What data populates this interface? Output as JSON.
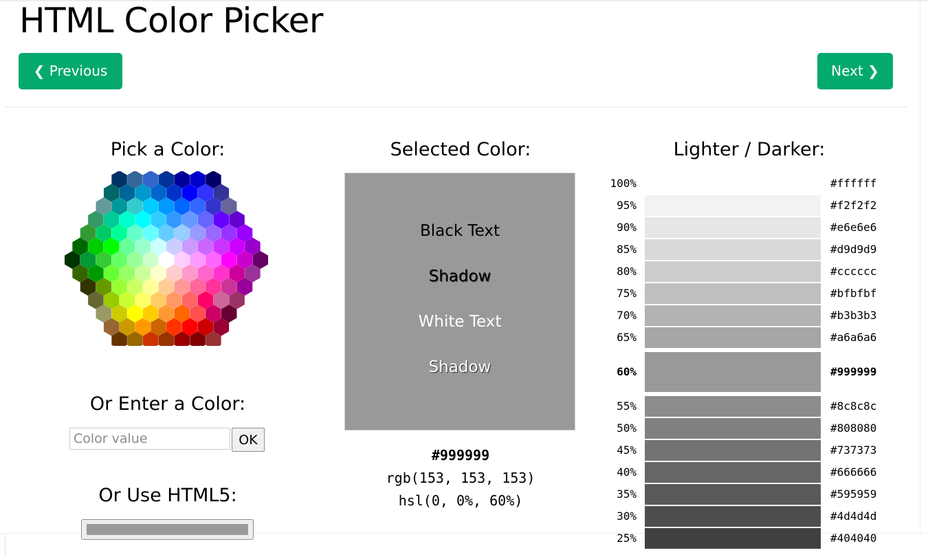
{
  "page": {
    "title": "HTML Color Picker"
  },
  "nav": {
    "previous_label": "Previous",
    "next_label": "Next",
    "prev_chevron": "❮",
    "next_chevron": "❯"
  },
  "picker": {
    "heading": "Pick a Color:",
    "hex_rows": [
      [
        "#003366",
        "#336699",
        "#3366cc",
        "#003399",
        "#000099",
        "#0000cc",
        "#000066"
      ],
      [
        "#006666",
        "#006699",
        "#0099cc",
        "#0066cc",
        "#0033cc",
        "#0000ff",
        "#3333ff",
        "#333399"
      ],
      [
        "#669999",
        "#009999",
        "#33cccc",
        "#00ccff",
        "#0099ff",
        "#0066ff",
        "#3366ff",
        "#3333cc",
        "#666699"
      ],
      [
        "#339966",
        "#00cc99",
        "#00ffcc",
        "#00ffff",
        "#33ccff",
        "#3399ff",
        "#6699ff",
        "#6666ff",
        "#6600ff",
        "#6600cc"
      ],
      [
        "#339933",
        "#00cc66",
        "#00ff99",
        "#66ffcc",
        "#66ffff",
        "#66ccff",
        "#99ccff",
        "#9999ff",
        "#9966ff",
        "#9933ff",
        "#9900ff"
      ],
      [
        "#006600",
        "#00cc00",
        "#00ff00",
        "#66ff99",
        "#99ffcc",
        "#ccffff",
        "#ccccff",
        "#cc99ff",
        "#cc66ff",
        "#cc33ff",
        "#cc00ff",
        "#9900cc"
      ],
      [
        "#003300",
        "#009933",
        "#33cc33",
        "#66ff66",
        "#99ff99",
        "#ccffcc",
        "#ffffff",
        "#ffccff",
        "#ff99ff",
        "#ff66ff",
        "#ff00ff",
        "#cc00cc",
        "#660066"
      ],
      [
        "#336600",
        "#009900",
        "#66ff33",
        "#99ff66",
        "#ccff99",
        "#ffffcc",
        "#ffcccc",
        "#ff99cc",
        "#ff66cc",
        "#ff33cc",
        "#cc0099",
        "#993399"
      ],
      [
        "#333300",
        "#669900",
        "#99ff33",
        "#ccff66",
        "#ffff99",
        "#ffcc99",
        "#ff9999",
        "#ff6699",
        "#ff3399",
        "#cc3399",
        "#990099"
      ],
      [
        "#666633",
        "#99cc00",
        "#ccff33",
        "#ffff66",
        "#ffcc66",
        "#ff9966",
        "#ff6666",
        "#ff0066",
        "#cc6699",
        "#993366"
      ],
      [
        "#999966",
        "#cccc00",
        "#ffff00",
        "#ffcc00",
        "#ff9933",
        "#ff6600",
        "#ff5050",
        "#cc0066",
        "#660033"
      ],
      [
        "#996633",
        "#cc9900",
        "#ff9900",
        "#cc6600",
        "#ff3300",
        "#ff0000",
        "#cc0000",
        "#990033"
      ],
      [
        "#663300",
        "#996600",
        "#cc3300",
        "#993300",
        "#990000",
        "#800000",
        "#993333"
      ]
    ]
  },
  "enter": {
    "heading": "Or Enter a Color:",
    "placeholder": "Color value",
    "ok_label": "OK"
  },
  "html5": {
    "heading": "Or Use HTML5:",
    "value": "#999999"
  },
  "selected": {
    "heading": "Selected Color:",
    "color": "#999999",
    "black_text": "Black Text",
    "black_shadow": "Shadow",
    "white_text": "White Text",
    "white_shadow": "Shadow",
    "hex": "#999999",
    "rgb": "rgb(153, 153, 153)",
    "hsl": "hsl(0, 0%, 60%)"
  },
  "shades": {
    "heading": "Lighter / Darker:",
    "rows": [
      {
        "pct": "100%",
        "hex": "#ffffff"
      },
      {
        "pct": "95%",
        "hex": "#f2f2f2"
      },
      {
        "pct": "90%",
        "hex": "#e6e6e6"
      },
      {
        "pct": "85%",
        "hex": "#d9d9d9"
      },
      {
        "pct": "80%",
        "hex": "#cccccc"
      },
      {
        "pct": "75%",
        "hex": "#bfbfbf"
      },
      {
        "pct": "70%",
        "hex": "#b3b3b3"
      },
      {
        "pct": "65%",
        "hex": "#a6a6a6"
      },
      {
        "pct": "60%",
        "hex": "#999999",
        "current": true
      },
      {
        "pct": "55%",
        "hex": "#8c8c8c"
      },
      {
        "pct": "50%",
        "hex": "#808080"
      },
      {
        "pct": "45%",
        "hex": "#737373"
      },
      {
        "pct": "40%",
        "hex": "#666666"
      },
      {
        "pct": "35%",
        "hex": "#595959"
      },
      {
        "pct": "30%",
        "hex": "#4d4d4d"
      },
      {
        "pct": "25%",
        "hex": "#404040"
      }
    ]
  },
  "colors": {
    "brand_green": "#04aa6d"
  }
}
